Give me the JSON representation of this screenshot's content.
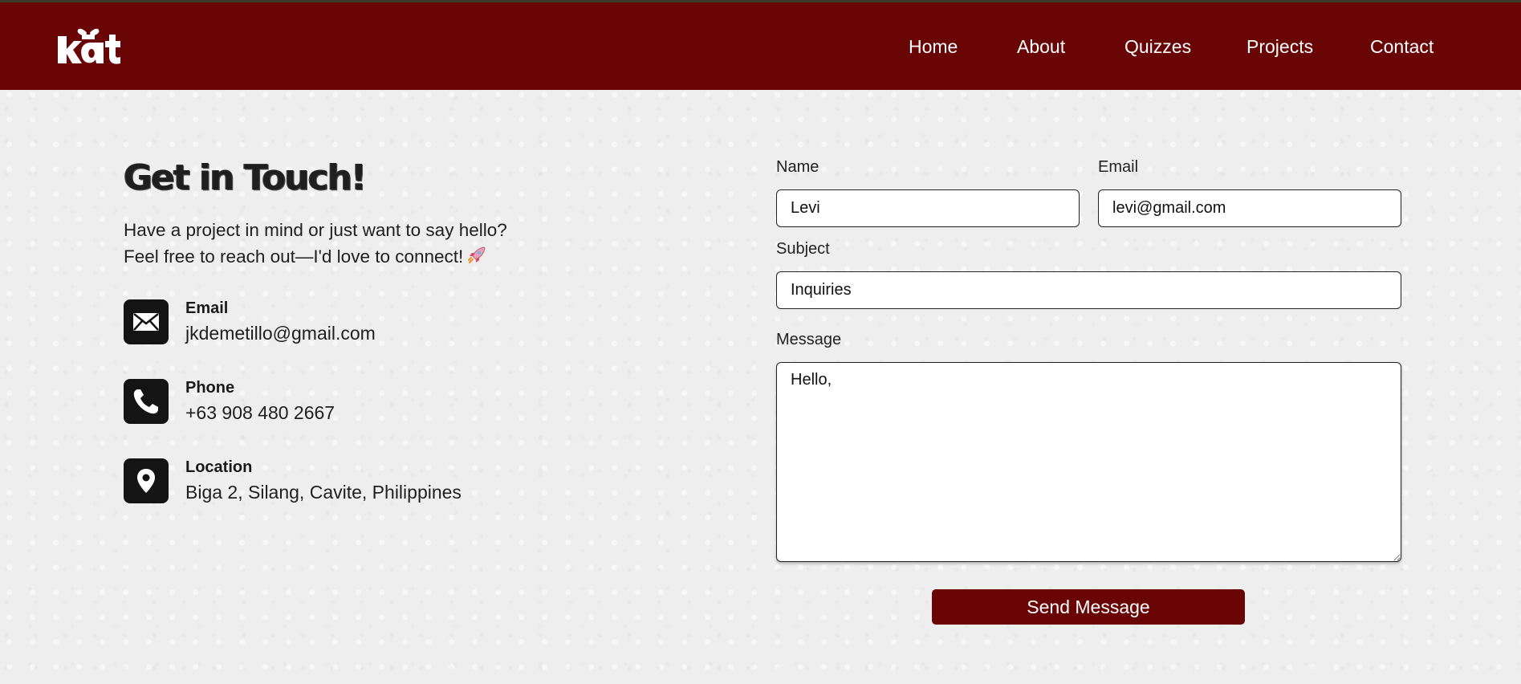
{
  "header": {
    "logo_text": "kat",
    "nav": [
      "Home",
      "About",
      "Quizzes",
      "Projects",
      "Contact"
    ]
  },
  "contact_info": {
    "title": "Get in Touch!",
    "intro_line1": "Have a project in mind or just want to say hello?",
    "intro_line2": "Feel free to reach out—I'd love to connect!",
    "items": [
      {
        "label": "Email",
        "value": "jkdemetillo@gmail.com",
        "icon": "envelope-icon"
      },
      {
        "label": "Phone",
        "value": "+63 908 480 2667",
        "icon": "phone-icon"
      },
      {
        "label": "Location",
        "value": "Biga 2, Silang, Cavite, Philippines",
        "icon": "location-pin-icon"
      }
    ]
  },
  "form": {
    "name_label": "Name",
    "name_value": "Levi",
    "email_label": "Email",
    "email_value": "levi@gmail.com",
    "subject_label": "Subject",
    "subject_value": "Inquiries",
    "message_label": "Message",
    "message_value": "Hello,",
    "submit_label": "Send Message"
  },
  "colors": {
    "brand": "#690505",
    "background": "#eeeeee",
    "icon_bg": "#141414"
  }
}
